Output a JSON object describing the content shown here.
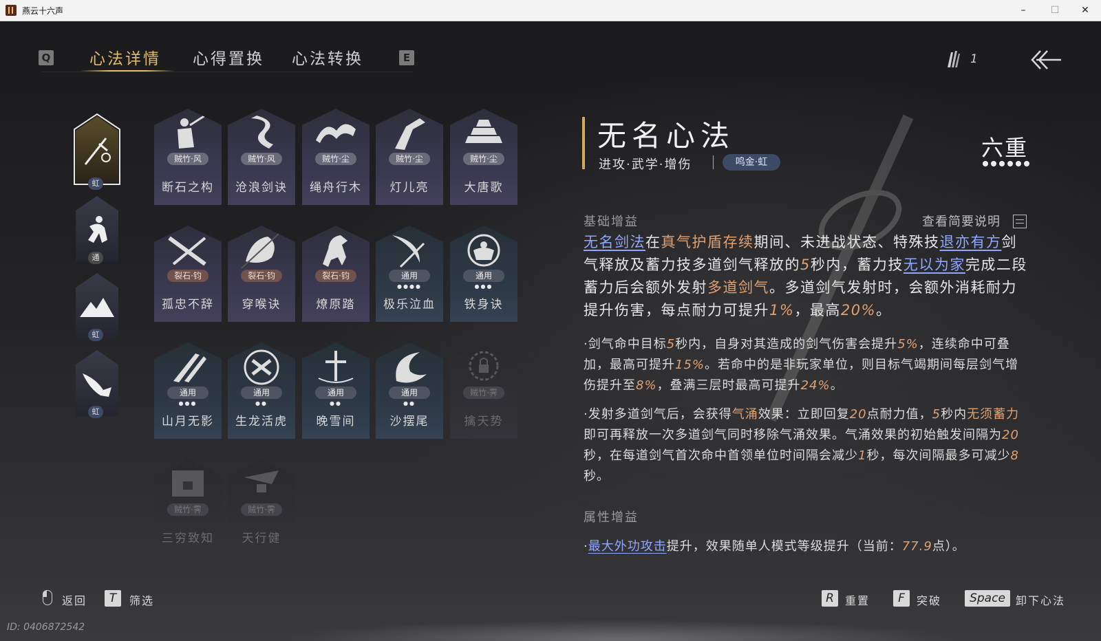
{
  "window": {
    "title": "燕云十六声",
    "min": "–",
    "max": "☐",
    "close": "✕"
  },
  "tabs": {
    "prev_key": "Q",
    "next_key": "E",
    "items": [
      {
        "label": "心法详情",
        "active": true
      },
      {
        "label": "心得置换",
        "active": false
      },
      {
        "label": "心法转换",
        "active": false
      }
    ]
  },
  "currency": {
    "icon": "feather-quill-icon",
    "count": "1"
  },
  "categories": [
    {
      "icon": "sword-icon",
      "badge": "虹",
      "badge_color": "#3d4a66",
      "selected": true
    },
    {
      "icon": "running-man-icon",
      "badge": "通",
      "badge_color": "#4a4a4a",
      "selected": false
    },
    {
      "icon": "mountain-icon",
      "badge": "虹",
      "badge_color": "#3d4a66",
      "selected": false
    },
    {
      "icon": "fish-icon",
      "badge": "虹",
      "badge_color": "#3d4a66",
      "selected": false
    }
  ],
  "cards": [
    {
      "name": "断石之构",
      "tag": "贼竹·风",
      "tag_type": "bamboo",
      "dots": "",
      "style": "purple",
      "icon": "swordsman-icon"
    },
    {
      "name": "沧浪剑诀",
      "tag": "贼竹·风",
      "tag_type": "bamboo",
      "dots": "",
      "style": "purple",
      "icon": "dragon-icon"
    },
    {
      "name": "绳舟行木",
      "tag": "贼竹·尘",
      "tag_type": "bamboo",
      "dots": "",
      "style": "purple",
      "icon": "wave-tree-icon"
    },
    {
      "name": "灯儿亮",
      "tag": "贼竹·尘",
      "tag_type": "bamboo",
      "dots": "",
      "style": "purple",
      "icon": "leaping-figure-icon"
    },
    {
      "name": "大唐歌",
      "tag": "贼竹·尘",
      "tag_type": "bamboo",
      "dots": "",
      "style": "purple",
      "icon": "palace-icon"
    },
    {
      "name": "孤忠不辞",
      "tag": "裂石·钧",
      "tag_type": "stone",
      "dots": "",
      "style": "purple",
      "icon": "crossed-weapons-icon"
    },
    {
      "name": "穿喉诀",
      "tag": "裂石·钧",
      "tag_type": "stone",
      "dots": "",
      "style": "purple",
      "icon": "spear-icon"
    },
    {
      "name": "燎原踏",
      "tag": "裂石·钧",
      "tag_type": "stone",
      "dots": "",
      "style": "purple",
      "icon": "horse-icon"
    },
    {
      "name": "极乐泣血",
      "tag": "通用",
      "tag_type": "common",
      "dots": "●●●●",
      "style": "blue",
      "icon": "crescent-blade-icon"
    },
    {
      "name": "铁身诀",
      "tag": "通用",
      "tag_type": "common",
      "dots": "●●●",
      "style": "blue",
      "icon": "strongman-icon"
    },
    {
      "name": "山月无影",
      "tag": "通用",
      "tag_type": "common",
      "dots": "●●●",
      "style": "blue",
      "icon": "claw-slash-icon"
    },
    {
      "name": "生龙活虎",
      "tag": "通用",
      "tag_type": "common",
      "dots": "●●",
      "style": "blue",
      "icon": "swirl-emblem-icon"
    },
    {
      "name": "晚雪间",
      "tag": "通用",
      "tag_type": "common",
      "dots": "●●",
      "style": "blue",
      "icon": "cross-sword-icon"
    },
    {
      "name": "沙摆尾",
      "tag": "通用",
      "tag_type": "common",
      "dots": "●●",
      "style": "blue",
      "icon": "feather-swirl-icon"
    },
    {
      "name": "擒天势",
      "tag": "贼竹·霁",
      "tag_type": "bamboo",
      "dots": "",
      "style": "locked",
      "icon": "lock-chain-icon"
    },
    {
      "name": "三穷致知",
      "tag": "贼竹·霁",
      "tag_type": "bamboo",
      "dots": "",
      "style": "locked",
      "icon": "lock-scroll-icon"
    },
    {
      "name": "天行健",
      "tag": "贼竹·霁",
      "tag_type": "bamboo",
      "dots": "",
      "style": "locked",
      "icon": "lock-bird-icon"
    }
  ],
  "detail": {
    "title": "无名心法",
    "tags": "进攻·武学·增伤",
    "badge": "鸣金·虹",
    "rank": "六重",
    "rank_dots": 6,
    "base_header": "基础增益",
    "view_brief": "查看简要说明",
    "main": {
      "s1": "无名剑法",
      "s2": "在",
      "s3": "真气护盾存续",
      "s4": "期间、未进战状态、特殊技",
      "s5": "退亦有方",
      "s6": "剑气释放及蓄力技多道剑气释放的",
      "s7": "5",
      "s8": "秒内，蓄力技",
      "s9": "无以为家",
      "s10": "完成二段蓄力后会额外发射",
      "s11": "多道剑气",
      "s12": "。多道剑气发射时，会额外消耗耐力提升伤害，每点耐力可提升",
      "s13": "1%",
      "s14": "，最高",
      "s15": "20%",
      "s16": "。"
    },
    "sub1": {
      "s1": "·剑气命中目标",
      "s2": "5",
      "s3": "秒内，自身对其造成的剑气伤害会提升",
      "s4": "5%",
      "s5": "，连续命中可叠加，最高可提升",
      "s6": "15%",
      "s7": "。若命中的是非玩家单位，则目标气竭期间每层剑气增伤提升至",
      "s8": "8%",
      "s9": "，叠满三层时最高可提升",
      "s10": "24%",
      "s11": "。"
    },
    "sub2": {
      "s1": "·发射多道剑气后，会获得",
      "s2": "气涌",
      "s3": "效果：立即回复",
      "s4": "20",
      "s5": "点耐力值，",
      "s6": "5",
      "s7": "秒内",
      "s8": "无须蓄力",
      "s9": "即可再释放一次多道剑气同时移除气涌效果。气涌效果的初始触发间隔为",
      "s10": "20",
      "s11": "秒，在每道剑气首次命中首领单位时间隔会减少",
      "s12": "1",
      "s13": "秒，每次间隔最多可减少",
      "s14": "8",
      "s15": "秒。"
    },
    "attr_header": "属性增益",
    "attr": {
      "s1": "·",
      "s2": "最大外功攻击",
      "s3": "提升，效果随单人模式等级提升（当前：",
      "s4": "77.9",
      "s5": "点）。"
    }
  },
  "hints": {
    "back": "返回",
    "filter_key": "T",
    "filter": "筛选",
    "reset_key": "R",
    "reset": "重置",
    "break_key": "F",
    "break": "突破",
    "unequip_key": "Space",
    "unequip": "卸下心法"
  },
  "footer": {
    "id": "ID: 0406872542"
  }
}
